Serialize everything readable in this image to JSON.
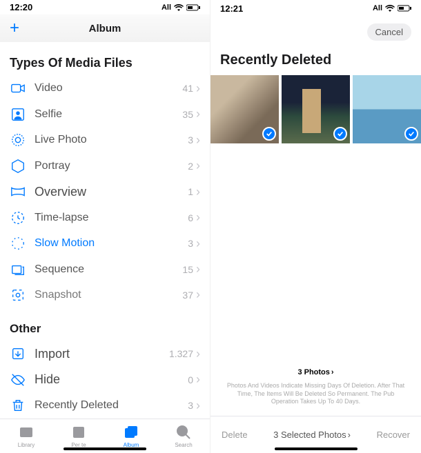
{
  "left": {
    "status": {
      "time": "12:20",
      "carrier": "All"
    },
    "header": {
      "title": "Album"
    },
    "sections": {
      "types": {
        "title": "Types Of Media Files",
        "rows": [
          {
            "label": "Video",
            "count": "41"
          },
          {
            "label": "Selfie",
            "count": "35"
          },
          {
            "label": "Live Photo",
            "count": "3"
          },
          {
            "label": "Portray",
            "count": "2"
          },
          {
            "label": "Overview",
            "count": "1"
          },
          {
            "label": "Time-lapse",
            "count": "6"
          },
          {
            "label": "Slow Motion",
            "count": "3"
          },
          {
            "label": "Sequence",
            "count": "15"
          },
          {
            "label": "Snapshot",
            "count": "37"
          }
        ]
      },
      "other": {
        "title": "Other",
        "rows": [
          {
            "label": "Import",
            "count": "1.327"
          },
          {
            "label": "Hide",
            "count": "0"
          },
          {
            "label": "Recently Deleted",
            "count": "3"
          }
        ]
      }
    },
    "tabs": [
      "Library",
      "Per te",
      "Album",
      "Search"
    ]
  },
  "right": {
    "status": {
      "time": "12:21",
      "carrier": "All"
    },
    "header": {
      "cancel": "Cancel"
    },
    "title": "Recently Deleted",
    "footer": {
      "count": "3 Photos",
      "note": "Photos And Videos Indicate Missing Days Of Deletion. After That Time, The Items Will Be Deleted So Permanent. The Pub Operation Takes Up To 40 Days."
    },
    "actions": {
      "delete": "Delete",
      "selected": "3 Selected Photos",
      "recover": "Recover"
    }
  }
}
